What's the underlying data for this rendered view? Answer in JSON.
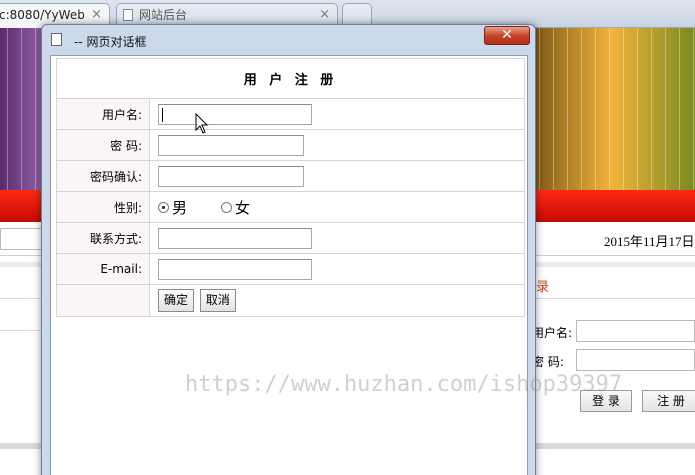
{
  "browser": {
    "tabs": [
      {
        "title": "c:8080/YyWeb",
        "close": "×"
      },
      {
        "title": "网站后台",
        "close": "×"
      }
    ]
  },
  "background_page": {
    "date_text": "2015年11月17日",
    "login_heading": "录",
    "username_label": "用户名:",
    "password_label": "密  码:",
    "login_button": "登 录",
    "register_button": "注 册"
  },
  "watermark": "https://www.huzhan.com/ishop39397",
  "dialog": {
    "title": "-- 网页对话框",
    "close_symbol": "✕",
    "form": {
      "heading": "用 户 注 册",
      "username_label": "用户名:",
      "password_label": "密  码:",
      "confirm_label": "密码确认:",
      "gender_label": "性别:",
      "gender_options": [
        "男",
        "女"
      ],
      "gender_selected": "男",
      "contact_label": "联系方式:",
      "email_label": "E-mail:",
      "username_value": "",
      "password_value": "",
      "confirm_value": "",
      "contact_value": "",
      "email_value": "",
      "confirm_button": "确定",
      "cancel_button": "取消"
    }
  },
  "colors": {
    "red_bar": "#e01a0a",
    "dialog_frame": "#cbd9ea",
    "label_cell_bg": "#faf5f8",
    "watermark": "#969696"
  }
}
